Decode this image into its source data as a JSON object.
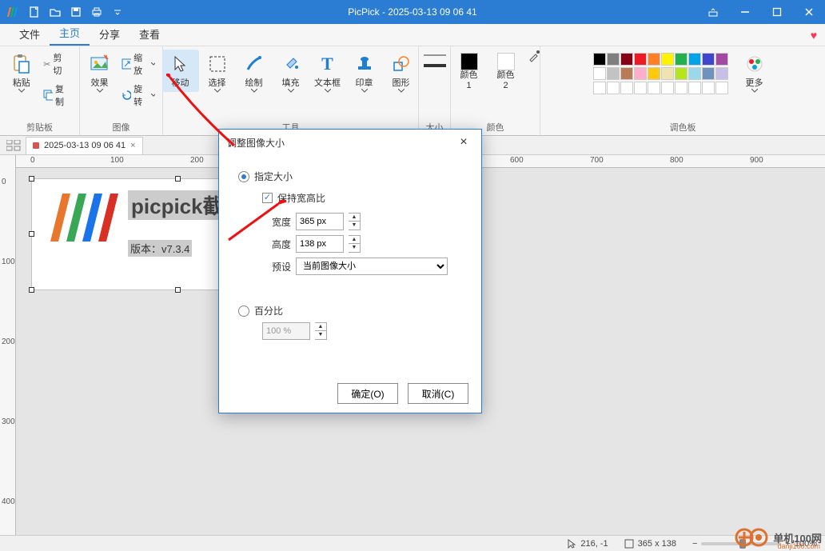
{
  "title": "PicPick - 2025-03-13 09 06 41",
  "menutabs": {
    "file": "文件",
    "home": "主页",
    "share": "分享",
    "view": "查看"
  },
  "panels": {
    "clipboard": {
      "label": "剪贴板",
      "paste": "粘贴",
      "cut": "剪切",
      "copy": "复制"
    },
    "image": {
      "label": "图像",
      "effect": "效果",
      "scale": "缩放",
      "rotate": "旋转"
    },
    "tools": {
      "label": "工具",
      "move": "移动",
      "select": "选择",
      "draw": "绘制",
      "fill": "填充",
      "text": "文本框",
      "stamp": "印章",
      "shapes": "图形"
    },
    "size": {
      "label": "大小"
    },
    "color": {
      "label": "颜色",
      "c1": "颜色\n1",
      "c2": "颜色\n2"
    },
    "palette": {
      "label": "调色板",
      "more": "更多"
    }
  },
  "palette_colors": {
    "row1": [
      "#000000",
      "#7f7f7f",
      "#880015",
      "#ed1c24",
      "#ff7f27",
      "#fff200",
      "#22b14c",
      "#00a2e8",
      "#3f48cc",
      "#a349a4"
    ],
    "row2": [
      "#ffffff",
      "#c3c3c3",
      "#b97a57",
      "#ffaec9",
      "#ffc90e",
      "#efe4b0",
      "#b5e61d",
      "#99d9ea",
      "#7092be",
      "#c8bfe7"
    ],
    "row3": [
      "#ffffff",
      "#ffffff",
      "#ffffff",
      "#ffffff",
      "#ffffff",
      "#ffffff",
      "#ffffff",
      "#ffffff",
      "#ffffff",
      "#ffffff"
    ]
  },
  "doctab": {
    "name": "2025-03-13 09 06 41"
  },
  "ruler_ticks_h": [
    "0",
    "100",
    "200",
    "600",
    "700",
    "800",
    "900"
  ],
  "canvas_content": {
    "title_text": "picpick截",
    "version_text": "版本：v7.3.4"
  },
  "dialog": {
    "title": "调整图像大小",
    "radio_size": "指定大小",
    "keep_ratio": "保持宽高比",
    "width_label": "宽度",
    "width_value": "365 px",
    "height_label": "高度",
    "height_value": "138 px",
    "preset_label": "预设",
    "preset_value": "当前图像大小",
    "radio_percent": "百分比",
    "percent_value": "100 %",
    "ok": "确定(O)",
    "cancel": "取消(C)"
  },
  "status": {
    "coords": "216, -1",
    "dim": "365 x 138",
    "zoom": "100%"
  },
  "watermark": {
    "text": "单机100网",
    "url": "danji100.com"
  }
}
